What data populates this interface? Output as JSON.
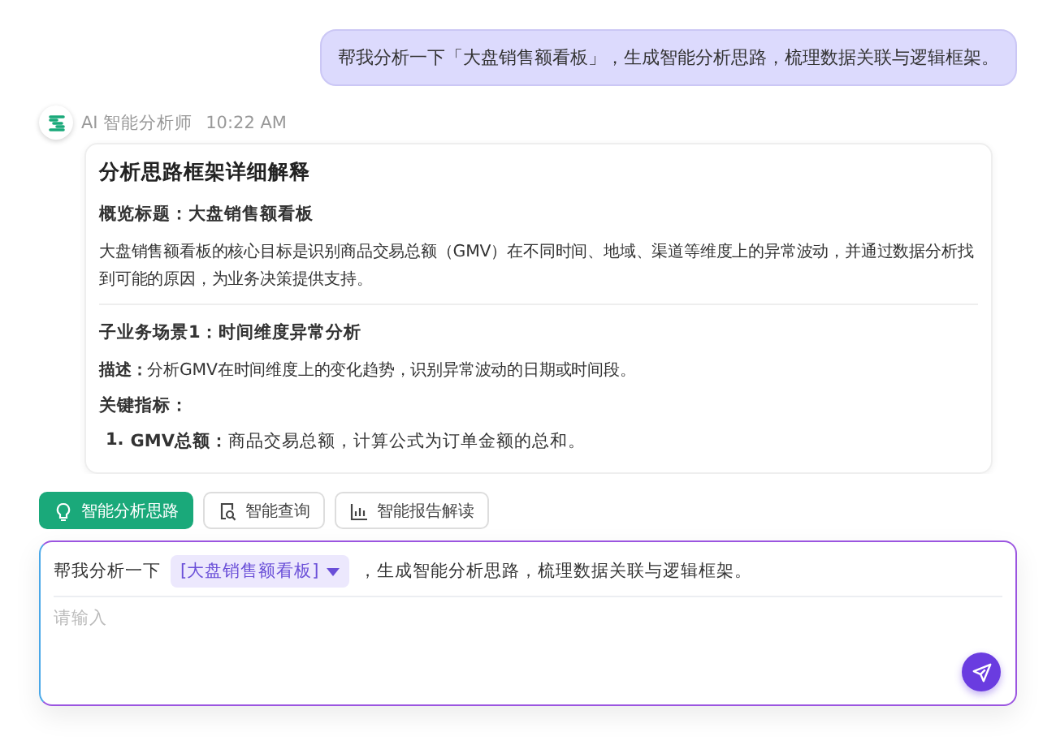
{
  "user_message": {
    "text": "帮我分析一下「大盘销售额看板」，生成智能分析思路，梳理数据关联与逻辑框架。"
  },
  "assistant": {
    "name": "AI 智能分析师",
    "time": "10:22 AM",
    "card": {
      "title": "分析思路框架详细解释",
      "blocks": [
        {
          "kind": "heading",
          "text": "概览标题：大盘销售额看板"
        },
        {
          "kind": "paragraph",
          "text": "大盘销售额看板的核心目标是识别商品交易总额（GMV）在不同时间、地域、渠道等维度上的异常波动，并通过数据分析找到可能的原因，为业务决策提供支持。"
        },
        {
          "kind": "divider"
        },
        {
          "kind": "heading",
          "text": "子业务场景1：时间维度异常分析"
        },
        {
          "kind": "paragraph",
          "text": "**描述：**分析GMV在时间维度上的变化趋势，识别异常波动的日期或时间段。"
        },
        {
          "kind": "heading",
          "text": "关键指标："
        },
        {
          "kind": "list_item",
          "marker": "1.",
          "text": "**GMV总额：**商品交易总额，计算公式为订单金额的总和。"
        }
      ]
    }
  },
  "modes": [
    {
      "label": "智能分析思路",
      "kind": "bulb",
      "selected": true
    },
    {
      "label": "智能查询",
      "kind": "doc-search",
      "selected": false
    },
    {
      "label": "智能报告解读",
      "kind": "chart",
      "selected": false
    }
  ],
  "composer": {
    "prefix": "帮我分析一下",
    "tag": "[大盘销售额看板]",
    "suffix": "，生成智能分析思路，梳理数据关联与逻辑框架。",
    "placeholder": "请输入"
  }
}
